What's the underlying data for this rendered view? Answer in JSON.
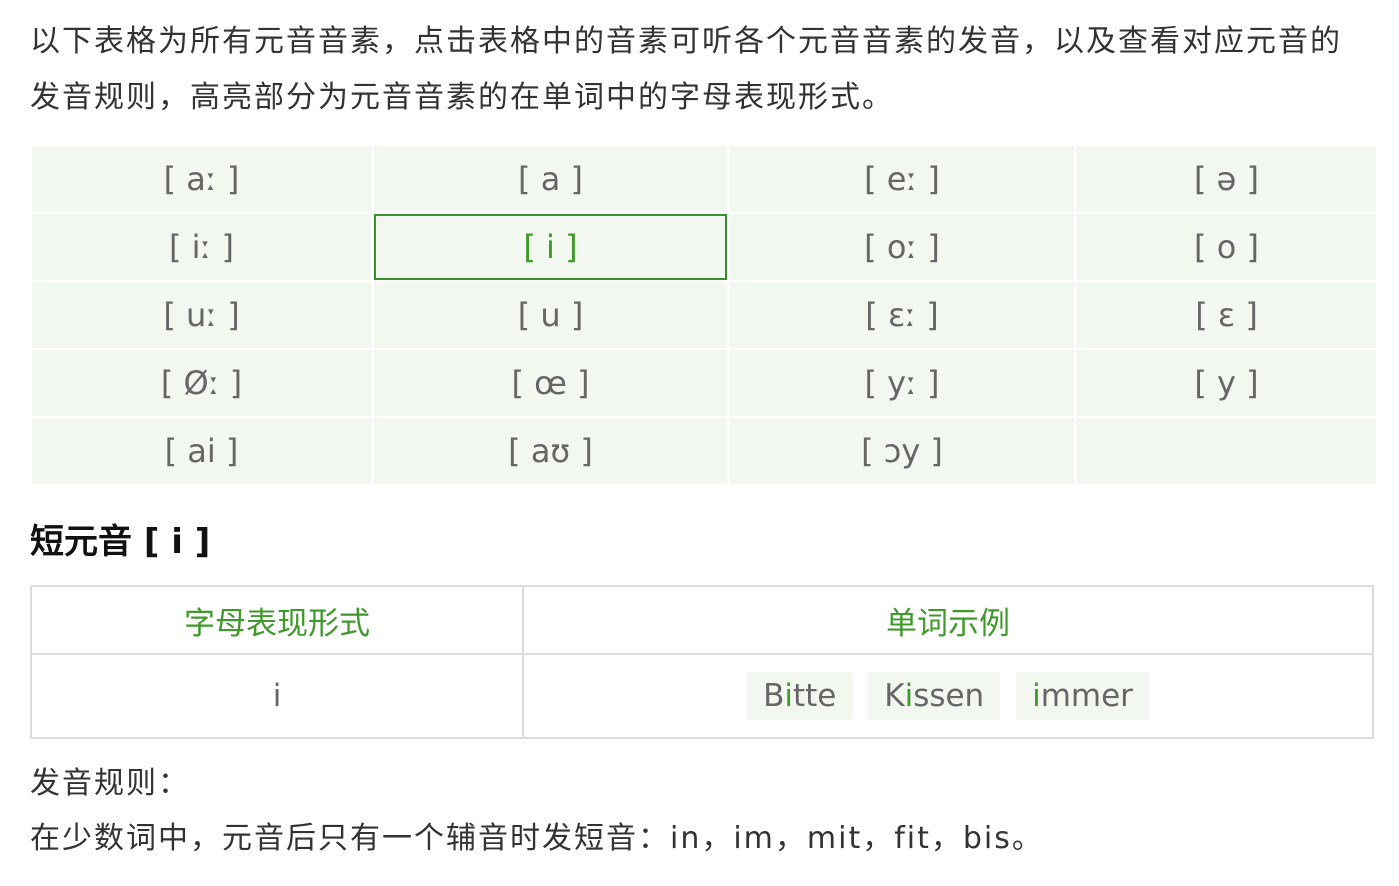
{
  "intro": "以下表格为所有元音音素，点击表格中的音素可听各个元音音素的发音，以及查看对应元音的发音规则，高亮部分为元音音素的在单词中的字母表现形式。",
  "phonemes": [
    "[ aː ]",
    "[ a ]",
    "[ eː ]",
    "[ ə ]",
    "[ iː ]",
    "[ i ]",
    "[ oː ]",
    "[ o ]",
    "[ uː ]",
    "[ u ]",
    "[ ɛː ]",
    "[ ɛ ]",
    "[ Øː ]",
    "[ œ ]",
    "[ yː ]",
    "[ y ]",
    "[ ai ]",
    "[ aʊ ]",
    "[ ɔy ]",
    ""
  ],
  "selected_phoneme": "[ i ]",
  "section_title": "短元音 [ i ]",
  "rule_table": {
    "headers": [
      "字母表现形式",
      "单词示例"
    ],
    "letter": "i",
    "examples": [
      {
        "before": "B",
        "hl": "i",
        "after": "tte"
      },
      {
        "before": "K",
        "hl": "i",
        "after": "ssen"
      },
      {
        "before": "",
        "hl": "i",
        "after": "mmer"
      }
    ]
  },
  "rule_label": "发音规则：",
  "rule_text": "在少数词中，元音后只有一个辅音时发短音：in，im，mit，fit，bis。",
  "colors": {
    "accent": "#3f9a2b",
    "cell_bg": "#f2f8f0",
    "border": "#dcdcdc"
  }
}
